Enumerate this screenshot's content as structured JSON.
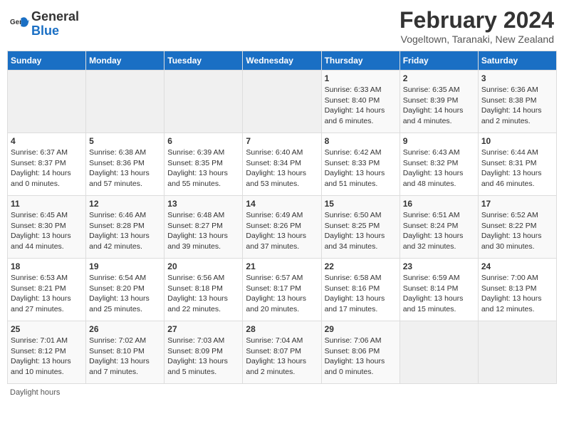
{
  "logo": {
    "text_general": "General",
    "text_blue": "Blue"
  },
  "title": "February 2024",
  "subtitle": "Vogeltown, Taranaki, New Zealand",
  "weekdays": [
    "Sunday",
    "Monday",
    "Tuesday",
    "Wednesday",
    "Thursday",
    "Friday",
    "Saturday"
  ],
  "weeks": [
    [
      {
        "day": "",
        "info": ""
      },
      {
        "day": "",
        "info": ""
      },
      {
        "day": "",
        "info": ""
      },
      {
        "day": "",
        "info": ""
      },
      {
        "day": "1",
        "info": "Sunrise: 6:33 AM\nSunset: 8:40 PM\nDaylight: 14 hours and 6 minutes."
      },
      {
        "day": "2",
        "info": "Sunrise: 6:35 AM\nSunset: 8:39 PM\nDaylight: 14 hours and 4 minutes."
      },
      {
        "day": "3",
        "info": "Sunrise: 6:36 AM\nSunset: 8:38 PM\nDaylight: 14 hours and 2 minutes."
      }
    ],
    [
      {
        "day": "4",
        "info": "Sunrise: 6:37 AM\nSunset: 8:37 PM\nDaylight: 14 hours and 0 minutes."
      },
      {
        "day": "5",
        "info": "Sunrise: 6:38 AM\nSunset: 8:36 PM\nDaylight: 13 hours and 57 minutes."
      },
      {
        "day": "6",
        "info": "Sunrise: 6:39 AM\nSunset: 8:35 PM\nDaylight: 13 hours and 55 minutes."
      },
      {
        "day": "7",
        "info": "Sunrise: 6:40 AM\nSunset: 8:34 PM\nDaylight: 13 hours and 53 minutes."
      },
      {
        "day": "8",
        "info": "Sunrise: 6:42 AM\nSunset: 8:33 PM\nDaylight: 13 hours and 51 minutes."
      },
      {
        "day": "9",
        "info": "Sunrise: 6:43 AM\nSunset: 8:32 PM\nDaylight: 13 hours and 48 minutes."
      },
      {
        "day": "10",
        "info": "Sunrise: 6:44 AM\nSunset: 8:31 PM\nDaylight: 13 hours and 46 minutes."
      }
    ],
    [
      {
        "day": "11",
        "info": "Sunrise: 6:45 AM\nSunset: 8:30 PM\nDaylight: 13 hours and 44 minutes."
      },
      {
        "day": "12",
        "info": "Sunrise: 6:46 AM\nSunset: 8:28 PM\nDaylight: 13 hours and 42 minutes."
      },
      {
        "day": "13",
        "info": "Sunrise: 6:48 AM\nSunset: 8:27 PM\nDaylight: 13 hours and 39 minutes."
      },
      {
        "day": "14",
        "info": "Sunrise: 6:49 AM\nSunset: 8:26 PM\nDaylight: 13 hours and 37 minutes."
      },
      {
        "day": "15",
        "info": "Sunrise: 6:50 AM\nSunset: 8:25 PM\nDaylight: 13 hours and 34 minutes."
      },
      {
        "day": "16",
        "info": "Sunrise: 6:51 AM\nSunset: 8:24 PM\nDaylight: 13 hours and 32 minutes."
      },
      {
        "day": "17",
        "info": "Sunrise: 6:52 AM\nSunset: 8:22 PM\nDaylight: 13 hours and 30 minutes."
      }
    ],
    [
      {
        "day": "18",
        "info": "Sunrise: 6:53 AM\nSunset: 8:21 PM\nDaylight: 13 hours and 27 minutes."
      },
      {
        "day": "19",
        "info": "Sunrise: 6:54 AM\nSunset: 8:20 PM\nDaylight: 13 hours and 25 minutes."
      },
      {
        "day": "20",
        "info": "Sunrise: 6:56 AM\nSunset: 8:18 PM\nDaylight: 13 hours and 22 minutes."
      },
      {
        "day": "21",
        "info": "Sunrise: 6:57 AM\nSunset: 8:17 PM\nDaylight: 13 hours and 20 minutes."
      },
      {
        "day": "22",
        "info": "Sunrise: 6:58 AM\nSunset: 8:16 PM\nDaylight: 13 hours and 17 minutes."
      },
      {
        "day": "23",
        "info": "Sunrise: 6:59 AM\nSunset: 8:14 PM\nDaylight: 13 hours and 15 minutes."
      },
      {
        "day": "24",
        "info": "Sunrise: 7:00 AM\nSunset: 8:13 PM\nDaylight: 13 hours and 12 minutes."
      }
    ],
    [
      {
        "day": "25",
        "info": "Sunrise: 7:01 AM\nSunset: 8:12 PM\nDaylight: 13 hours and 10 minutes."
      },
      {
        "day": "26",
        "info": "Sunrise: 7:02 AM\nSunset: 8:10 PM\nDaylight: 13 hours and 7 minutes."
      },
      {
        "day": "27",
        "info": "Sunrise: 7:03 AM\nSunset: 8:09 PM\nDaylight: 13 hours and 5 minutes."
      },
      {
        "day": "28",
        "info": "Sunrise: 7:04 AM\nSunset: 8:07 PM\nDaylight: 13 hours and 2 minutes."
      },
      {
        "day": "29",
        "info": "Sunrise: 7:06 AM\nSunset: 8:06 PM\nDaylight: 13 hours and 0 minutes."
      },
      {
        "day": "",
        "info": ""
      },
      {
        "day": "",
        "info": ""
      }
    ]
  ],
  "footer": "Daylight hours"
}
